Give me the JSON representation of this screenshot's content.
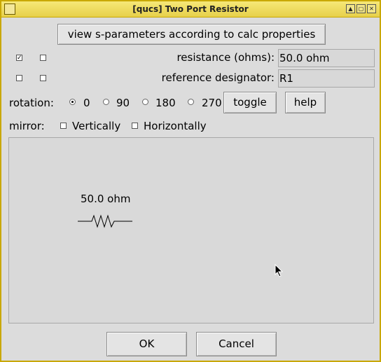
{
  "window": {
    "title": "[qucs] Two Port Resistor"
  },
  "actions": {
    "view_sparams": "view s-parameters according to calc properties"
  },
  "fields": {
    "resistance": {
      "label": "resistance (ohms):",
      "value": "50.0 ohm",
      "show_checked": true,
      "show2_checked": false
    },
    "designator": {
      "label": "reference designator:",
      "value": "R1",
      "show_checked": false,
      "show2_checked": false
    }
  },
  "rotation": {
    "label": "rotation:",
    "options": [
      "0",
      "90",
      "180",
      "270"
    ],
    "selected": "0",
    "toggle": "toggle",
    "help": "help"
  },
  "mirror": {
    "label": "mirror:",
    "vertical": "Vertically",
    "horizontal": "Horizontally"
  },
  "preview": {
    "value_label": "50.0 ohm"
  },
  "footer": {
    "ok": "OK",
    "cancel": "Cancel"
  }
}
